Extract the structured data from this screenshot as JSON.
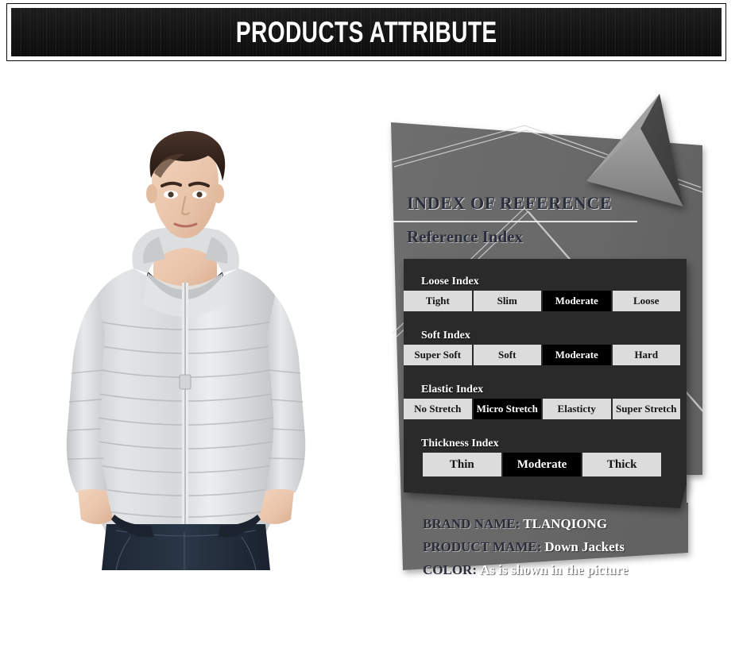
{
  "banner": {
    "title": "PRODUCTS ATTRIBUTE"
  },
  "photo": {
    "alt_name": "male-model-wearing-light-grey-hooded-down-jacket",
    "jacket_color": "#d9dbdd",
    "tshirt_color": "#161616",
    "jeans_color": "#26303e"
  },
  "panel": {
    "heading_main": "INDEX OF REFERENCE",
    "heading_sub": "Reference Index",
    "accent_dark": "#2b2b2b",
    "accent_grey": "#6b6b6b",
    "chip_bg": "#dcdcdc",
    "chip_active_bg": "#000000"
  },
  "indexes": [
    {
      "label": "Loose Index",
      "options": [
        {
          "text": "Tight",
          "selected": false
        },
        {
          "text": "Slim",
          "selected": false
        },
        {
          "text": "Moderate",
          "selected": true
        },
        {
          "text": "Loose",
          "selected": false
        }
      ]
    },
    {
      "label": "Soft Index",
      "options": [
        {
          "text": "Super Soft",
          "selected": false
        },
        {
          "text": "Soft",
          "selected": false
        },
        {
          "text": "Moderate",
          "selected": true
        },
        {
          "text": "Hard",
          "selected": false
        }
      ]
    },
    {
      "label": "Elastic Index",
      "options": [
        {
          "text": "No Stretch",
          "selected": false
        },
        {
          "text": "Micro Stretch",
          "selected": true
        },
        {
          "text": "Elasticty",
          "selected": false
        },
        {
          "text": "Super Stretch",
          "selected": false
        }
      ]
    },
    {
      "label": "Thickness Index",
      "options": [
        {
          "text": "Thin",
          "selected": false
        },
        {
          "text": "Moderate",
          "selected": true
        },
        {
          "text": "Thick",
          "selected": false
        }
      ]
    }
  ],
  "specs": [
    {
      "key": "BRAND NAME:",
      "value": "TLANQIONG"
    },
    {
      "key": "PRODUCT MAME:",
      "value": "Down Jackets"
    },
    {
      "key": "COLOR:",
      "value": "As is shown in the picture"
    }
  ]
}
